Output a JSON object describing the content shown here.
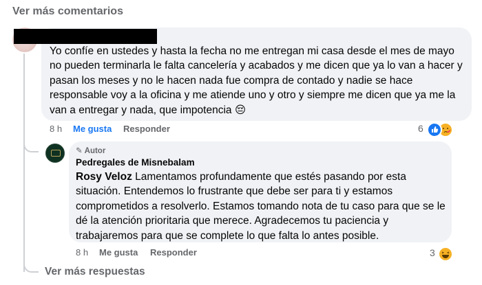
{
  "header": {
    "see_more_comments": "Ver más comentarios"
  },
  "comment1": {
    "text": "Yo confíe en ustedes y hasta la fecha no me entregan mi casa desde el mes de mayo no pueden terminarla le falta cancelería y acabados y me dicen que ya lo van a hacer y pasan los meses y no le hacen nada fue compra de contado y nadie se hace responsable voy a la oficina y me atiende uno y otro y siempre me dicen que ya me la van a entregar y nada, que impotencia 😔",
    "time": "8 h",
    "like_label": "Me gusta",
    "reply_label": "Responder",
    "reaction_count": "6",
    "reactions": [
      "like-icon",
      "care-icon"
    ]
  },
  "reply": {
    "badge": "Autor",
    "author": "Pedregales de Misnebalam",
    "tag": "Rosy Veloz",
    "text": "Lamentamos profundamente que estés pasando por esta situación. Entendemos lo frustrante que debe ser para ti y estamos comprometidos a resolverlo. Estamos tomando nota de tu caso para que se le dé la atención prioritaria que merece. Agradecemos tu paciencia y trabajaremos para que se complete lo que falta lo antes posible.",
    "time": "8 h",
    "like_label": "Me gusta",
    "reply_label": "Responder",
    "reaction_count": "3",
    "reactions": [
      "haha-icon"
    ]
  },
  "footer": {
    "see_more_replies": "Ver más respuestas"
  },
  "colors": {
    "accent": "#1877f2",
    "bubble": "#f0f2f5",
    "muted": "#65676b",
    "line": "#ced0d4"
  }
}
